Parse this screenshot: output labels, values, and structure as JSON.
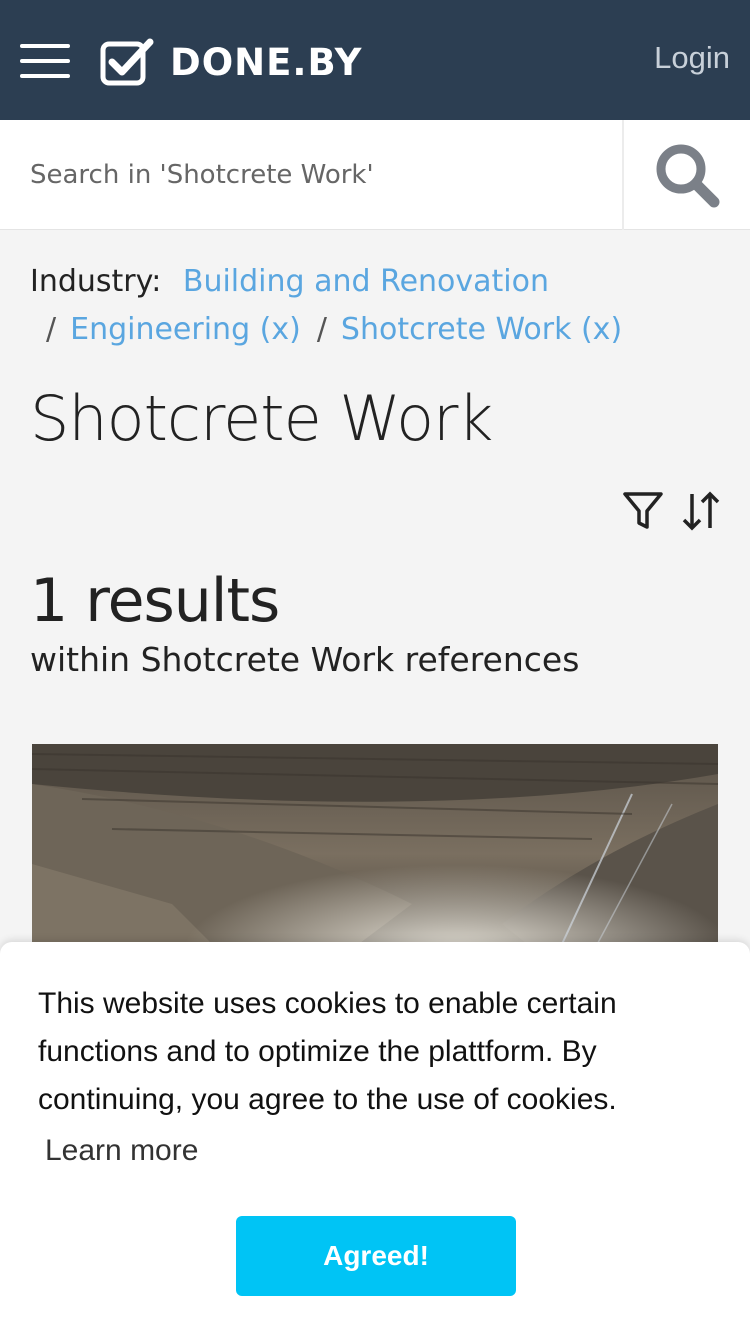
{
  "header": {
    "brand": "DONE.BY",
    "login_label": "Login"
  },
  "search": {
    "placeholder": "Search in 'Shotcrete Work'"
  },
  "breadcrumb": {
    "label": "Industry:",
    "items": [
      {
        "label": "Building and Renovation"
      },
      {
        "label": "Engineering (x)"
      },
      {
        "label": "Shotcrete Work (x)"
      }
    ],
    "separator": "/"
  },
  "page": {
    "title": "Shotcrete Work",
    "results_count": "1 results",
    "results_subtitle": "within Shotcrete Work references"
  },
  "cookie": {
    "message": "This website uses cookies to enable certain functions and to optimize the plattform. By continuing, you agree to the use of cookies.",
    "learn_more": "Learn more",
    "agree_label": "Agreed!"
  },
  "colors": {
    "header_bg": "#2c3e52",
    "link": "#5aa6e0",
    "agree_button": "#00c4f5"
  }
}
